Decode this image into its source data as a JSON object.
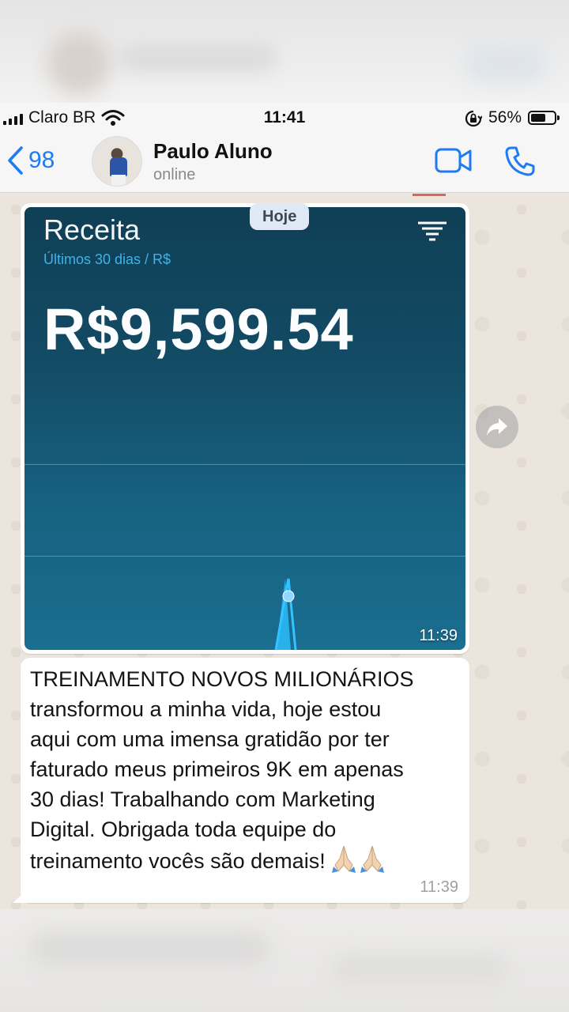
{
  "status_bar": {
    "carrier": "Claro BR",
    "time": "11:41",
    "battery": "56%"
  },
  "header": {
    "back_count": "98",
    "contact_name": "Paulo Aluno",
    "contact_status": "online"
  },
  "chat": {
    "date_label": "Hoje",
    "image_message": {
      "card_title": "Receita",
      "card_subtitle": "Últimos 30 dias / R$",
      "amount": "R$9,599.54",
      "time": "11:39"
    },
    "text_message": {
      "lines": [
        "TREINAMENTO NOVOS MILIONÁRIOS",
        "transformou a minha vida, hoje estou",
        "aqui com uma imensa gratidão por ter",
        "faturado meus primeiros 9K em apenas",
        "30 dias! Trabalhando com Marketing",
        "Digital. Obrigada toda equipe do",
        "treinamento vocês são demais!"
      ],
      "time": "11:39"
    }
  },
  "colors": {
    "ios_blue": "#1f7bf2",
    "card_top": "#0f3f55",
    "card_bottom": "#1a6e90",
    "chart_line": "#2ab8f5",
    "subtitle_blue": "#3fb3ea"
  },
  "icons": [
    "signal-icon",
    "wifi-icon",
    "orientation-lock-icon",
    "battery-icon",
    "back-chevron-icon",
    "video-call-icon",
    "phone-icon",
    "filter-icon",
    "forward-icon",
    "folded-hands-emoji"
  ]
}
